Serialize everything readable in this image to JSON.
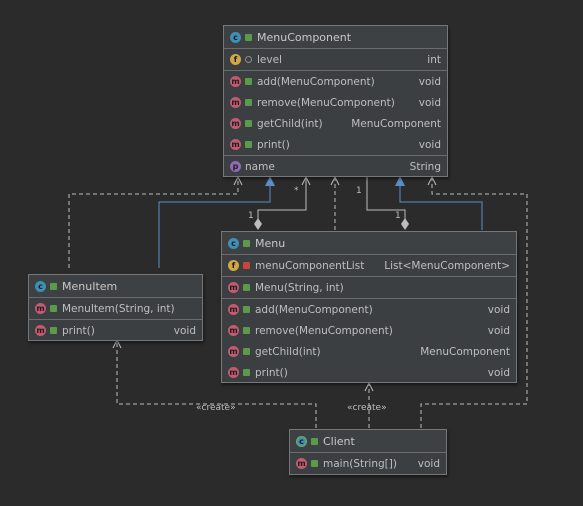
{
  "diagram": {
    "menu_component": {
      "name": "MenuComponent",
      "icon": "abstract-class-icon",
      "fields": [
        {
          "name": "level",
          "type": "int",
          "icon": "field-icon"
        }
      ],
      "methods": [
        {
          "name": "add(MenuComponent)",
          "type": "void"
        },
        {
          "name": "remove(MenuComponent)",
          "type": "void"
        },
        {
          "name": "getChild(int)",
          "type": "MenuComponent"
        },
        {
          "name": "print()",
          "type": "void"
        }
      ],
      "properties": [
        {
          "name": "name",
          "type": "String",
          "icon": "property-icon"
        }
      ]
    },
    "menu_item": {
      "name": "MenuItem",
      "icon": "class-icon",
      "methods": [
        {
          "name": "MenuItem(String, int)",
          "type": ""
        },
        {
          "name": "print()",
          "type": "void"
        }
      ]
    },
    "menu": {
      "name": "Menu",
      "icon": "class-icon",
      "fields": [
        {
          "name": "menuComponentList",
          "type": "List<MenuComponent>",
          "icon": "field-icon"
        }
      ],
      "methods": [
        {
          "name": "Menu(String, int)",
          "type": ""
        },
        {
          "name": "add(MenuComponent)",
          "type": "void"
        },
        {
          "name": "remove(MenuComponent)",
          "type": "void"
        },
        {
          "name": "getChild(int)",
          "type": "MenuComponent"
        },
        {
          "name": "print()",
          "type": "void"
        }
      ]
    },
    "client": {
      "name": "Client",
      "icon": "main-class-icon",
      "methods": [
        {
          "name": "main(String[])",
          "type": "void"
        }
      ]
    },
    "labels": {
      "mult_star": "*",
      "mult_one_a": "1",
      "mult_one_b": "1",
      "mult_one_c": "1",
      "create_a": "«create»",
      "create_b": "«create»"
    },
    "colors": {
      "background": "#2b2b2b",
      "inheritance": "#5b8ec9",
      "dependency": "#bdbdbd"
    }
  }
}
